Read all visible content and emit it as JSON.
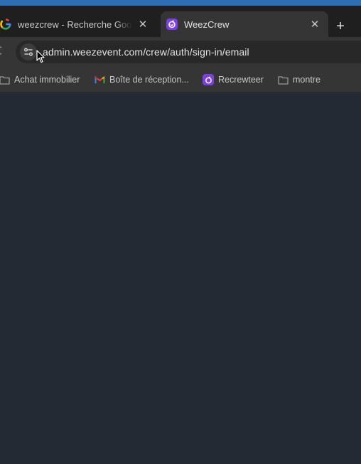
{
  "browser": {
    "tabs": [
      {
        "title": "weezcrew - Recherche Google",
        "favicon": "google-icon",
        "active": false
      },
      {
        "title": "WeezCrew",
        "favicon": "weezcrew-icon",
        "active": true
      }
    ],
    "new_tab_icon": "plus-icon",
    "close_icon": "close-icon",
    "address_bar": {
      "url": "admin.weezevent.com/crew/auth/sign-in/email"
    },
    "bookmarks": [
      {
        "label": "Achat immobilier",
        "icon": "folder-icon"
      },
      {
        "label": "Boîte de réception...",
        "icon": "gmail-icon"
      },
      {
        "label": "Recrewteer",
        "icon": "weezcrew-icon"
      },
      {
        "label": "montre",
        "icon": "folder-icon"
      }
    ]
  },
  "colors": {
    "tabstrip": "#1f1f1f",
    "toolbar": "#353535",
    "content_background": "#232a33",
    "accent_purple": "#7b3fe4"
  }
}
